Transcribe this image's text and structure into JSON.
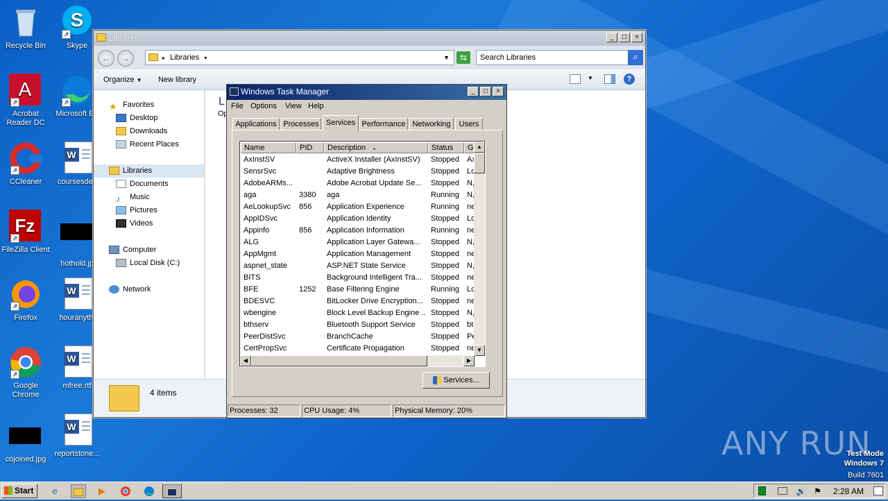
{
  "desktop": {
    "icons": [
      {
        "label": "Recycle Bin"
      },
      {
        "label": "Skype"
      },
      {
        "label": "Acrobat Reader DC"
      },
      {
        "label": "Microsoft Ed"
      },
      {
        "label": "CCleaner"
      },
      {
        "label": "coursesdes"
      },
      {
        "label": "FileZilla Client"
      },
      {
        "label": "hothold.jp"
      },
      {
        "label": "Firefox"
      },
      {
        "label": "houranythi"
      },
      {
        "label": "Google Chrome"
      },
      {
        "label": "mfree.rtf"
      },
      {
        "label": "cojoined.jpg"
      },
      {
        "label": "reportstone..."
      }
    ],
    "watermark": "ANY RUN",
    "mode": {
      "line1": "Test Mode",
      "line2": "Windows 7",
      "line3": "Build 7601"
    }
  },
  "explorer": {
    "title": "Libraries",
    "address": "Libraries",
    "search_placeholder": "Search Libraries",
    "organize": "Organize",
    "new_library": "New library",
    "nav": {
      "favorites": "Favorites",
      "desktop": "Desktop",
      "downloads": "Downloads",
      "recent": "Recent Places",
      "libraries": "Libraries",
      "documents": "Documents",
      "music": "Music",
      "pictures": "Pictures",
      "videos": "Videos",
      "computer": "Computer",
      "local_disk": "Local Disk (C:)",
      "network": "Network"
    },
    "content_title": "L",
    "content_sub": "Op",
    "status": "4 items"
  },
  "taskmgr": {
    "title": "Windows Task Manager",
    "menu": [
      "File",
      "Options",
      "View",
      "Help"
    ],
    "tabs": [
      "Applications",
      "Processes",
      "Services",
      "Performance",
      "Networking",
      "Users"
    ],
    "active_tab": "Services",
    "columns": [
      "Name",
      "PID",
      "Description",
      "Status",
      "G"
    ],
    "rows": [
      {
        "name": "AxInstSV",
        "pid": "",
        "desc": "ActiveX Installer (AxInstSV)",
        "status": "Stopped",
        "group": "Ax"
      },
      {
        "name": "SensrSvc",
        "pid": "",
        "desc": "Adaptive Brightness",
        "status": "Stopped",
        "group": "Lo"
      },
      {
        "name": "AdobeARMs...",
        "pid": "",
        "desc": "Adobe Acrobat Update Se...",
        "status": "Stopped",
        "group": "N,"
      },
      {
        "name": "aga",
        "pid": "3380",
        "desc": "aga",
        "status": "Running",
        "group": "N,"
      },
      {
        "name": "AeLookupSvc",
        "pid": "856",
        "desc": "Application Experience",
        "status": "Running",
        "group": "ne"
      },
      {
        "name": "AppIDSvc",
        "pid": "",
        "desc": "Application Identity",
        "status": "Stopped",
        "group": "Lo"
      },
      {
        "name": "Appinfo",
        "pid": "856",
        "desc": "Application Information",
        "status": "Running",
        "group": "ne"
      },
      {
        "name": "ALG",
        "pid": "",
        "desc": "Application Layer Gatewa...",
        "status": "Stopped",
        "group": "N,"
      },
      {
        "name": "AppMgmt",
        "pid": "",
        "desc": "Application Management",
        "status": "Stopped",
        "group": "ne"
      },
      {
        "name": "aspnet_state",
        "pid": "",
        "desc": "ASP.NET State Service",
        "status": "Stopped",
        "group": "N,"
      },
      {
        "name": "BITS",
        "pid": "",
        "desc": "Background Intelligent Tra...",
        "status": "Stopped",
        "group": "ne"
      },
      {
        "name": "BFE",
        "pid": "1252",
        "desc": "Base Filtering Engine",
        "status": "Running",
        "group": "Lo"
      },
      {
        "name": "BDESVC",
        "pid": "",
        "desc": "BitLocker Drive Encryption...",
        "status": "Stopped",
        "group": "ne"
      },
      {
        "name": "wbengine",
        "pid": "",
        "desc": "Block Level Backup Engine ...",
        "status": "Stopped",
        "group": "N,"
      },
      {
        "name": "bthserv",
        "pid": "",
        "desc": "Bluetooth Support Service",
        "status": "Stopped",
        "group": "bt"
      },
      {
        "name": "PeerDistSvc",
        "pid": "",
        "desc": "BranchCache",
        "status": "Stopped",
        "group": "Pe"
      },
      {
        "name": "CertPropSvc",
        "pid": "",
        "desc": "Certificate Propagation",
        "status": "Stopped",
        "group": "ne"
      }
    ],
    "services_button": "Services...",
    "status": {
      "processes": "Processes: 32",
      "cpu": "CPU Usage: 4%",
      "memory": "Physical Memory: 20%"
    }
  },
  "taskbar": {
    "start": "Start",
    "clock": "2:28 AM"
  }
}
